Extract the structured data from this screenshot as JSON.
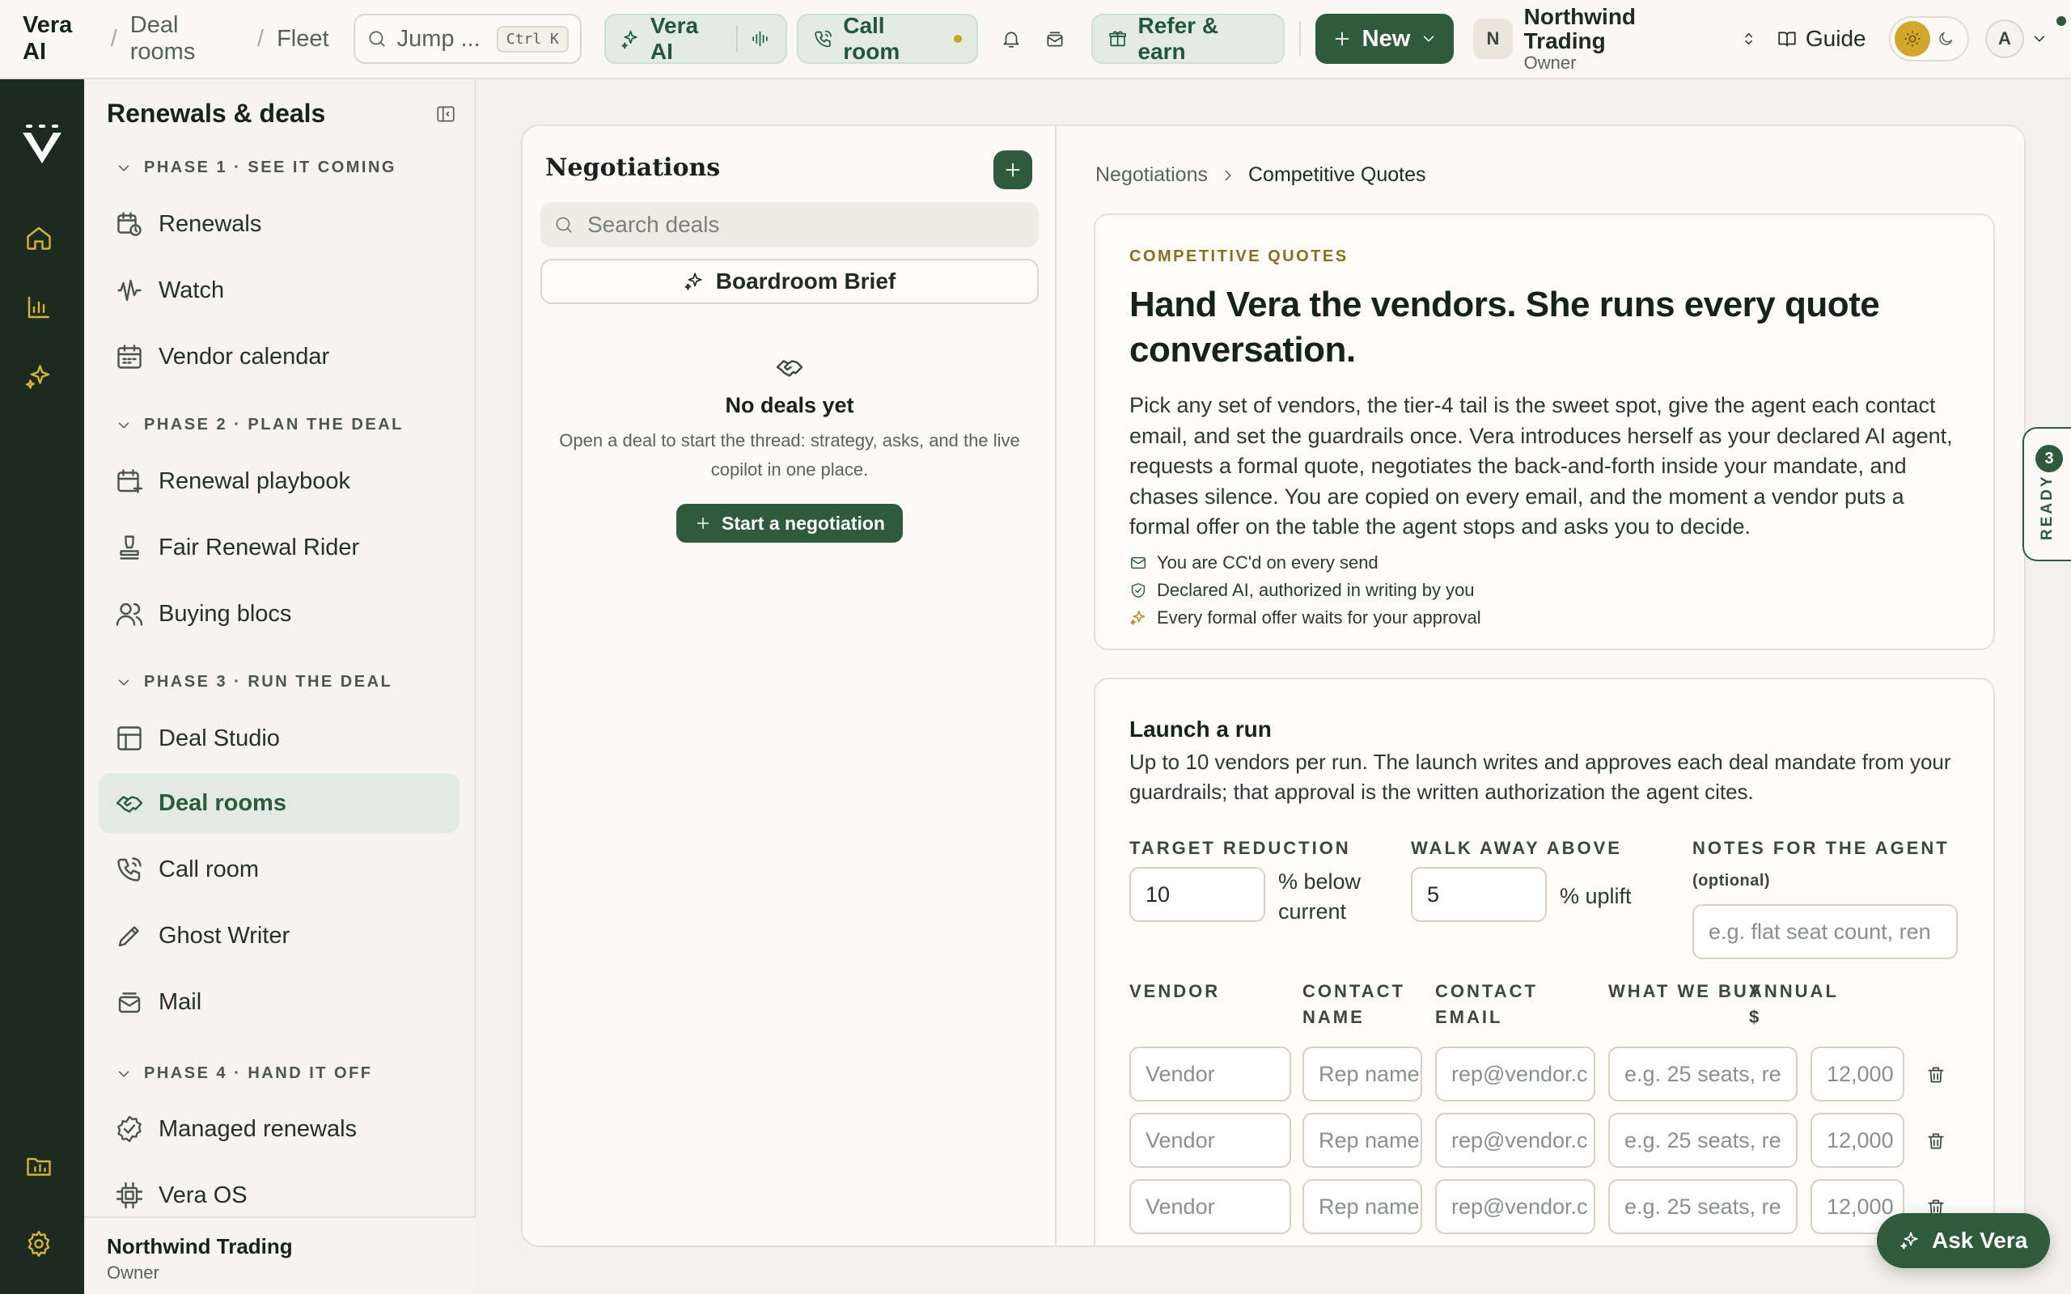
{
  "colors": {
    "brand_green": "#2e5b3c",
    "rail_bg": "#1b2b20",
    "accent_gold": "#d8b23b",
    "canvas": "#f4f1ea"
  },
  "topbar": {
    "breadcrumb": [
      "Vera AI",
      "Deal rooms",
      "Fleet"
    ],
    "jump_label": "Jump ...",
    "jump_shortcut": "Ctrl K",
    "vera_label": "Vera AI",
    "call_room_label": "Call room",
    "refer_label": "Refer & earn",
    "new_label": "New",
    "org_initial": "N",
    "org_name": "Northwind Trading",
    "org_role": "Owner",
    "guide_label": "Guide",
    "account_initial": "A"
  },
  "rail": {
    "icons": [
      "vera-logo",
      "home-icon",
      "analytics-icon",
      "sparkle-icon",
      "folder-icon",
      "settings-icon"
    ]
  },
  "sidebar": {
    "title": "Renewals & deals",
    "phases": [
      {
        "label": "PHASE 1 · SEE IT COMING",
        "items": [
          "Renewals",
          "Watch",
          "Vendor calendar"
        ]
      },
      {
        "label": "PHASE 2 · PLAN THE DEAL",
        "items": [
          "Renewal playbook",
          "Fair Renewal Rider",
          "Buying blocs"
        ]
      },
      {
        "label": "PHASE 3 · RUN THE DEAL",
        "items": [
          "Deal Studio",
          "Deal rooms",
          "Call room",
          "Ghost Writer",
          "Mail"
        ]
      },
      {
        "label": "PHASE 4 · HAND IT OFF",
        "items": [
          "Managed renewals",
          "Vera OS"
        ]
      }
    ],
    "active_item": "Deal rooms",
    "footer_name": "Northwind Trading",
    "footer_role": "Owner"
  },
  "negotiations": {
    "title": "Negotiations",
    "search_placeholder": "Search deals",
    "brief_label": "Boardroom Brief",
    "empty_title": "No deals yet",
    "empty_desc": "Open a deal to start the thread: strategy, asks, and the live copilot in one place.",
    "start_label": "Start a negotiation"
  },
  "detail": {
    "breadcrumb_parent": "Negotiations",
    "breadcrumb_current": "Competitive Quotes",
    "eyebrow": "COMPETITIVE QUOTES",
    "headline": "Hand Vera the vendors. She runs every quote conversation.",
    "body": "Pick any set of vendors, the tier-4 tail is the sweet spot, give the agent each contact email, and set the guardrails once. Vera introduces herself as your declared AI agent, requests a formal quote, negotiates the back-and-forth inside your mandate, and chases silence. You are copied on every email, and the moment a vendor puts a formal offer on the table the agent stops and asks you to decide.",
    "features": [
      "You are CC'd on every send",
      "Declared AI, authorized in writing by you",
      "Every formal offer waits for your approval"
    ]
  },
  "launch": {
    "title": "Launch a run",
    "subtitle": "Up to 10 vendors per run. The launch writes and approves each deal mandate from your guardrails; that approval is the written authorization the agent cites.",
    "target_label": "TARGET REDUCTION",
    "target_value": "10",
    "target_unit": "% below current",
    "walk_label": "WALK AWAY ABOVE",
    "walk_value": "5",
    "walk_unit": "% uplift",
    "notes_label": "NOTES FOR THE AGENT",
    "notes_optional": "(optional)",
    "notes_placeholder": "e.g. flat seat count, ren",
    "columns": [
      "VENDOR",
      "CONTACT NAME",
      "CONTACT EMAIL",
      "WHAT WE BUY",
      "ANNUAL $"
    ],
    "row_placeholders": {
      "vendor": "Vendor",
      "contact": "Rep name",
      "email": "rep@vendor.c",
      "buy": "e.g. 25 seats, re",
      "annual": "12,000"
    },
    "row_count": 3
  },
  "floating": {
    "ready_count": "3",
    "ready_label": "READY",
    "ask_label": "Ask Vera"
  }
}
